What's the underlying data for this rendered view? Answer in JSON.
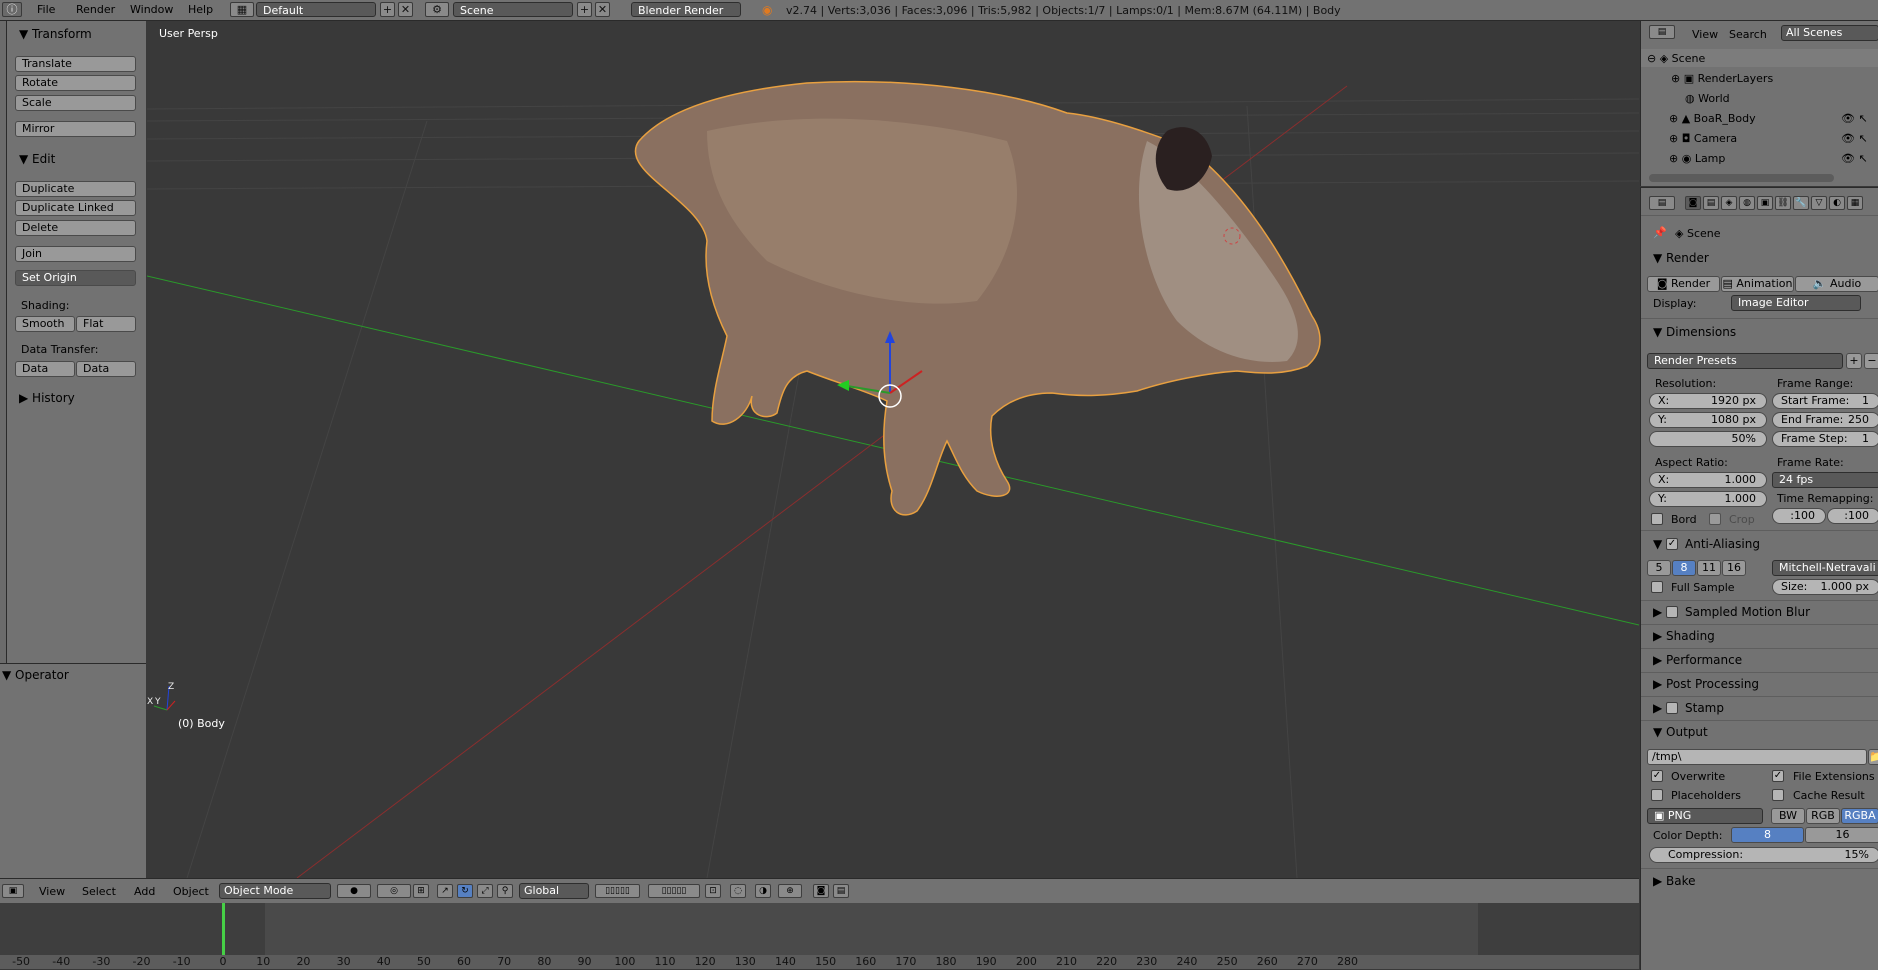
{
  "topbar": {
    "menus": [
      "File",
      "Render",
      "Window",
      "Help"
    ],
    "layout": "Default",
    "scene": "Scene",
    "engine": "Blender Render",
    "stats": "v2.74 | Verts:3,036 | Faces:3,096 | Tris:5,982 | Objects:1/7 | Lamps:0/1 | Mem:8.67M (64.11M) | Body"
  },
  "toolshelf": {
    "transform_title": "Transform",
    "translate": "Translate",
    "rotate": "Rotate",
    "scale": "Scale",
    "mirror": "Mirror",
    "edit_title": "Edit",
    "duplicate": "Duplicate",
    "duplicate_linked": "Duplicate Linked",
    "delete": "Delete",
    "join": "Join",
    "set_origin": "Set Origin",
    "shading_label": "Shading:",
    "smooth": "Smooth",
    "flat": "Flat",
    "data_transfer_label": "Data Transfer:",
    "data": "Data",
    "data_layout": "Data Layo",
    "history_title": "History",
    "operator_title": "Operator"
  },
  "viewport": {
    "view_label": "User Persp",
    "object_label": "(0) Body",
    "axis_x": "X",
    "axis_y": "Y",
    "axis_z": "Z"
  },
  "view3d_header": {
    "menus": [
      "View",
      "Select",
      "Add",
      "Object"
    ],
    "mode": "Object Mode",
    "orientation": "Global"
  },
  "timeline": {
    "current_frame": 0,
    "ticks": [
      "-50",
      "-40",
      "-30",
      "-20",
      "-10",
      "0",
      "10",
      "20",
      "30",
      "40",
      "50",
      "60",
      "70",
      "80",
      "90",
      "100",
      "110",
      "120",
      "130",
      "140",
      "150",
      "160",
      "170",
      "180",
      "190",
      "200",
      "210",
      "220",
      "230",
      "240",
      "250",
      "260",
      "270",
      "280"
    ]
  },
  "outliner": {
    "view": "View",
    "search": "Search",
    "filter": "All Scenes",
    "items": [
      "Scene",
      "RenderLayers",
      "World",
      "BoaR_Body",
      "Camera",
      "Lamp"
    ]
  },
  "properties": {
    "context": "Scene",
    "render_title": "Render",
    "render_btn": "Render",
    "animation_btn": "Animation",
    "audio_btn": "Audio",
    "display_label": "Display:",
    "display_value": "Image Editor",
    "dimensions_title": "Dimensions",
    "render_presets": "Render Presets",
    "resolution_label": "Resolution:",
    "res_x_label": "X:",
    "res_x": "1920 px",
    "res_y_label": "Y:",
    "res_y": "1080 px",
    "res_pct": "50%",
    "frame_range_label": "Frame Range:",
    "start_label": "Start Frame:",
    "start": "1",
    "end_label": "End Frame:",
    "end": "250",
    "step_label": "Frame Step:",
    "step": "1",
    "aspect_label": "Aspect Ratio:",
    "asp_x_label": "X:",
    "asp_x": "1.000",
    "asp_y_label": "Y:",
    "asp_y": "1.000",
    "frame_rate_label": "Frame Rate:",
    "frame_rate": "24 fps",
    "time_remap_label": "Time Remapping:",
    "remap_old": ":100",
    "remap_new": ":100",
    "bord": "Bord",
    "crop": "Crop",
    "aa_title": "Anti-Aliasing",
    "aa_samples": [
      "5",
      "8",
      "11",
      "16"
    ],
    "aa_filter": "Mitchell-Netravali",
    "full_sample": "Full Sample",
    "size_label": "Size:",
    "size_value": "1.000 px",
    "motion_blur_title": "Sampled Motion Blur",
    "shading_title": "Shading",
    "performance_title": "Performance",
    "post_processing_title": "Post Processing",
    "stamp_title": "Stamp",
    "output_title": "Output",
    "output_path": "/tmp\\",
    "overwrite": "Overwrite",
    "file_extensions": "File Extensions",
    "placeholders": "Placeholders",
    "cache_result": "Cache Result",
    "format": "PNG",
    "bw": "BW",
    "rgb": "RGB",
    "rgba": "RGBA",
    "color_depth_label": "Color Depth:",
    "depth_8": "8",
    "depth_16": "16",
    "compression_label": "Compression:",
    "compression_value": "15%",
    "bake_title": "Bake"
  },
  "colors": {
    "selection_outline": "#e8a040",
    "axis_x": "#b03030",
    "axis_y": "#2a9a2a",
    "selected_button": "#5680c2"
  }
}
